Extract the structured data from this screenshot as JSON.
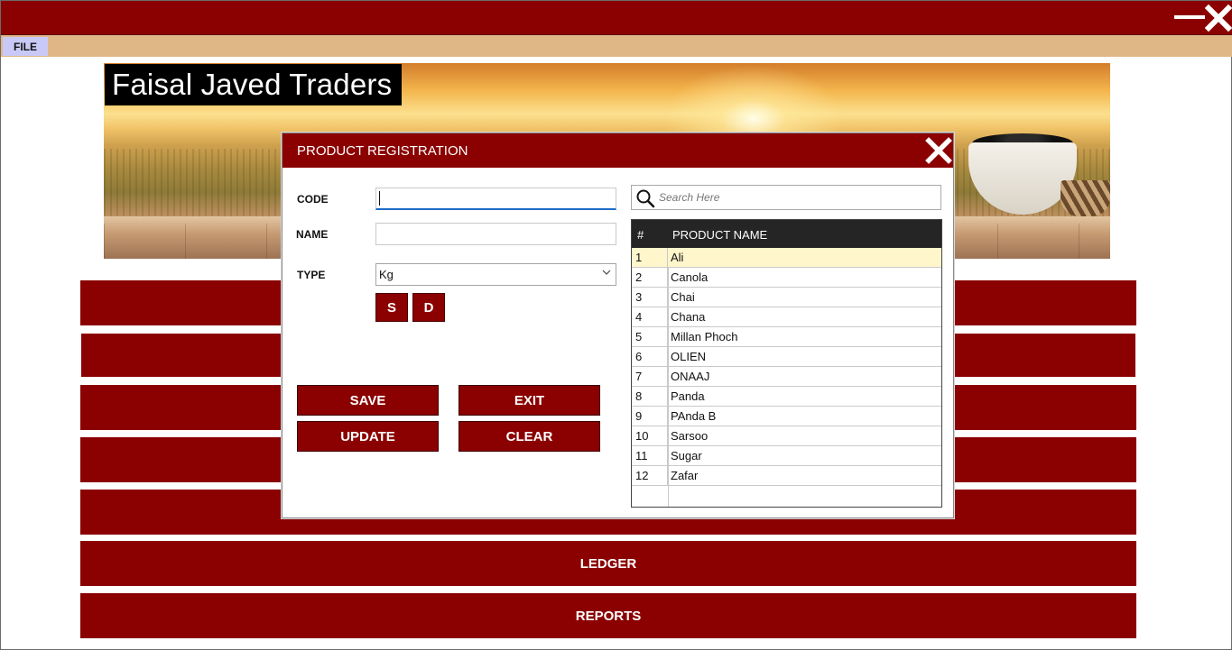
{
  "window": {
    "brand": "Faisal Javed Traders"
  },
  "menu": {
    "file_label": "FILE"
  },
  "background_buttons": [
    {
      "label": "",
      "name": "menu-button-1"
    },
    {
      "label": "",
      "name": "menu-button-2"
    },
    {
      "label": "",
      "name": "menu-button-3"
    },
    {
      "label": "",
      "name": "menu-button-4"
    },
    {
      "label": "",
      "name": "menu-button-5"
    },
    {
      "label": "LEDGER",
      "name": "ledger-button"
    },
    {
      "label": "REPORTS",
      "name": "reports-button"
    }
  ],
  "dialog": {
    "title": "PRODUCT REGISTRATION",
    "code_label": "CODE",
    "code_value": "",
    "name_label": "NAME",
    "name_value": "",
    "type_label": "TYPE",
    "type_selected": "Kg",
    "s_button": "S",
    "d_button": "D",
    "save": "SAVE",
    "exit": "EXIT",
    "update": "UPDATE",
    "clear": "CLEAR",
    "search_placeholder": "Search Here"
  },
  "grid": {
    "columns": [
      "#",
      "PRODUCT NAME"
    ],
    "rows": [
      {
        "num": "1",
        "name": "Ali"
      },
      {
        "num": "2",
        "name": "Canola"
      },
      {
        "num": "3",
        "name": "Chai"
      },
      {
        "num": "4",
        "name": "Chana"
      },
      {
        "num": "5",
        "name": "Millan Phoch"
      },
      {
        "num": "6",
        "name": "OLIEN"
      },
      {
        "num": "7",
        "name": "ONAAJ"
      },
      {
        "num": "8",
        "name": "Panda"
      },
      {
        "num": "9",
        "name": "PAnda B"
      },
      {
        "num": "10",
        "name": "Sarsoo"
      },
      {
        "num": "11",
        "name": "Sugar"
      },
      {
        "num": "12",
        "name": "Zafar"
      }
    ],
    "selected_row": 0
  },
  "colors": {
    "primary": "#8b0000",
    "menubar": "#dfb787",
    "file_menu_bg": "#c9c9f7",
    "grid_header": "#252525",
    "selected_row": "#fff6cc"
  }
}
